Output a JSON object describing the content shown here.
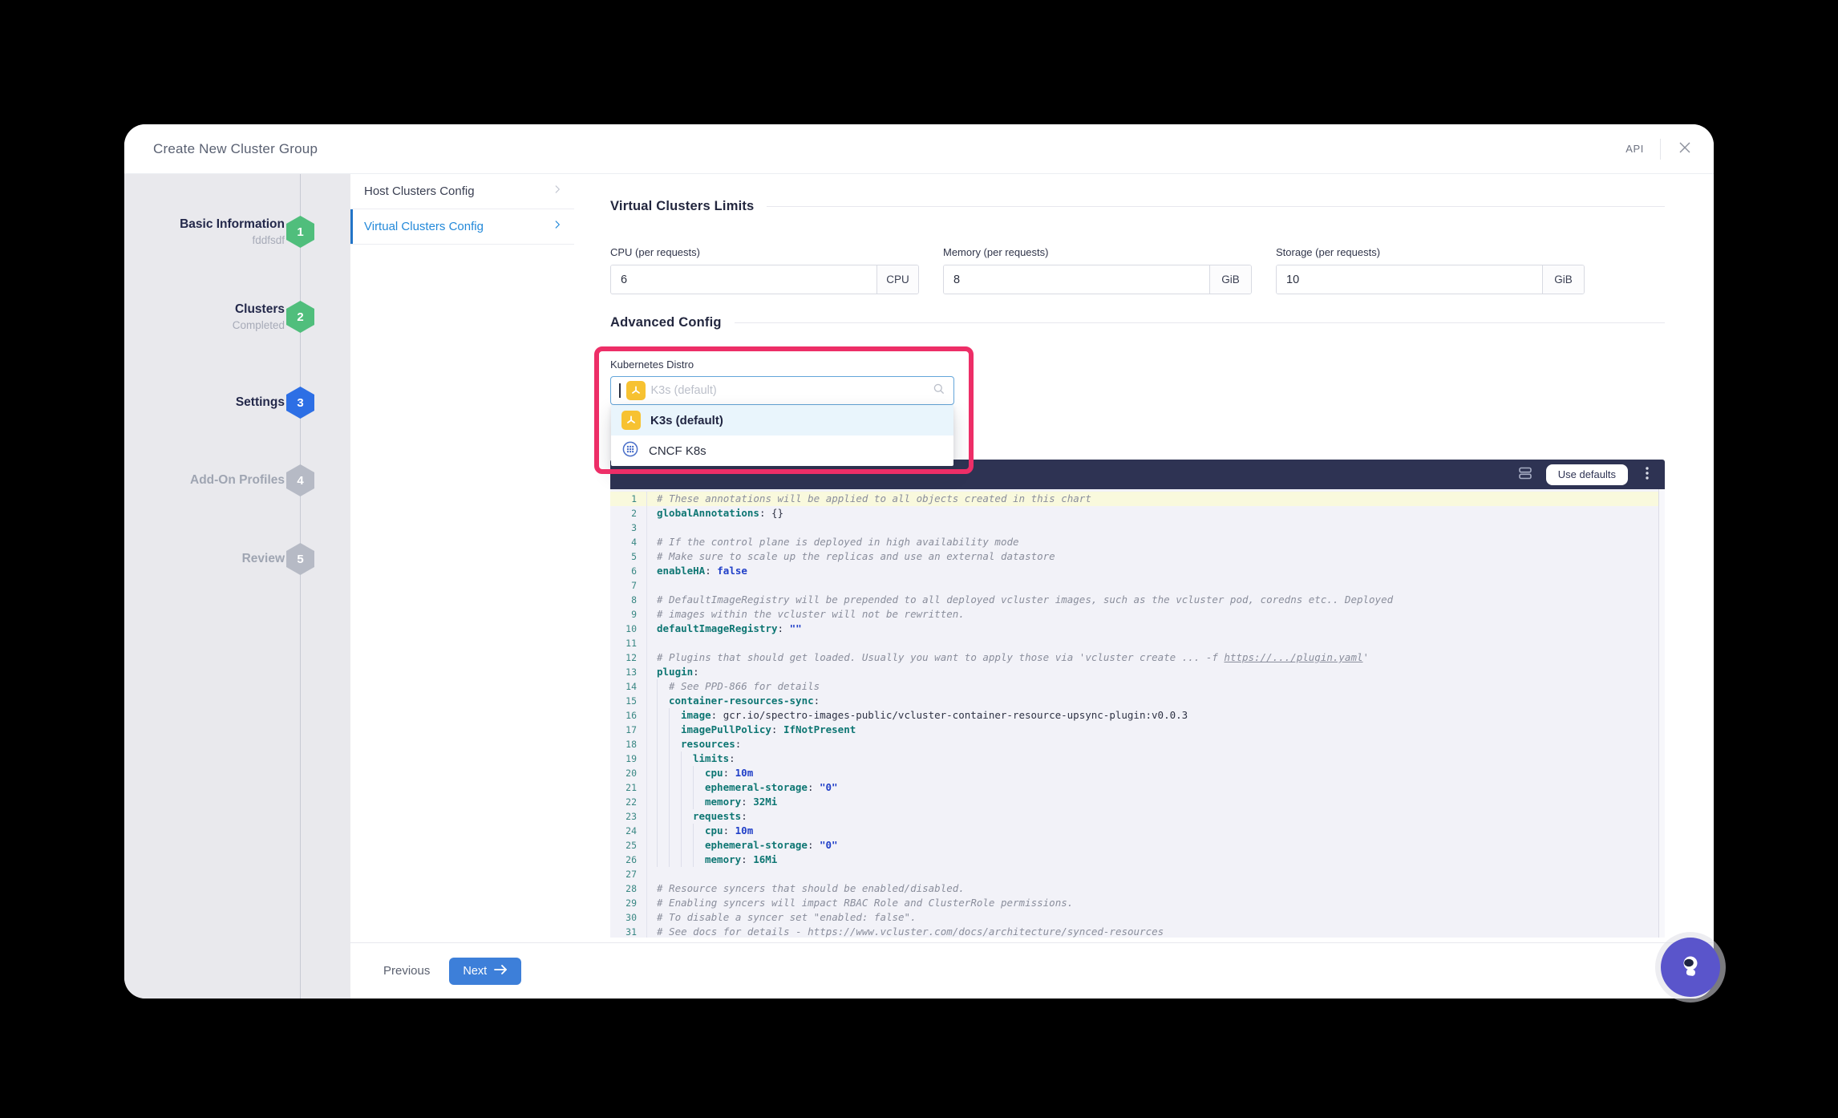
{
  "modal": {
    "title": "Create New Cluster Group",
    "api_label": "API"
  },
  "wizard": {
    "steps": [
      {
        "number": "1",
        "label": "Basic Information",
        "sublabel": "fddfsdf",
        "state": "completed"
      },
      {
        "number": "2",
        "label": "Clusters",
        "sublabel": "Completed",
        "state": "completed"
      },
      {
        "number": "3",
        "label": "Settings",
        "sublabel": "",
        "state": "active"
      },
      {
        "number": "4",
        "label": "Add-On Profiles",
        "sublabel": "",
        "state": "pending"
      },
      {
        "number": "5",
        "label": "Review",
        "sublabel": "",
        "state": "pending"
      }
    ]
  },
  "config_menu": {
    "items": [
      {
        "label": "Host Clusters Config",
        "active": false
      },
      {
        "label": "Virtual Clusters Config",
        "active": true
      }
    ]
  },
  "limits_section": {
    "title": "Virtual Clusters Limits",
    "fields": [
      {
        "label": "CPU (per requests)",
        "value": "6",
        "unit": "CPU"
      },
      {
        "label": "Memory (per requests)",
        "value": "8",
        "unit": "GiB"
      },
      {
        "label": "Storage (per requests)",
        "value": "10",
        "unit": "GiB"
      }
    ]
  },
  "advanced_section": {
    "title": "Advanced Config",
    "distro_label": "Kubernetes Distro",
    "distro_placeholder": "K3s (default)",
    "options": [
      {
        "label": "K3s (default)",
        "icon": "k3s",
        "selected": true
      },
      {
        "label": "CNCF K8s",
        "icon": "k8s",
        "selected": false
      }
    ]
  },
  "editor": {
    "use_defaults_label": "Use defaults",
    "lines": [
      {
        "n": 1,
        "hl": true,
        "segs": [
          [
            "cm",
            "# These annotations will be applied to all objects created in this chart"
          ]
        ]
      },
      {
        "n": 2,
        "segs": [
          [
            "k",
            "globalAnnotations"
          ],
          [
            "pl",
            ": {}"
          ]
        ]
      },
      {
        "n": 3,
        "segs": []
      },
      {
        "n": 4,
        "segs": [
          [
            "cm",
            "# If the control plane is deployed in high availability mode"
          ]
        ]
      },
      {
        "n": 5,
        "segs": [
          [
            "cm",
            "# Make sure to scale up the replicas and use an external datastore"
          ]
        ]
      },
      {
        "n": 6,
        "segs": [
          [
            "k",
            "enableHA"
          ],
          [
            "pl",
            ": "
          ],
          [
            "num",
            "false"
          ]
        ]
      },
      {
        "n": 7,
        "segs": []
      },
      {
        "n": 8,
        "segs": [
          [
            "cm",
            "# DefaultImageRegistry will be prepended to all deployed vcluster images, such as the vcluster pod, coredns etc.. Deployed"
          ]
        ]
      },
      {
        "n": 9,
        "segs": [
          [
            "cm",
            "# images within the vcluster will not be rewritten."
          ]
        ]
      },
      {
        "n": 10,
        "segs": [
          [
            "k",
            "defaultImageRegistry"
          ],
          [
            "pl",
            ": "
          ],
          [
            "num",
            "\"\""
          ]
        ]
      },
      {
        "n": 11,
        "segs": []
      },
      {
        "n": 12,
        "segs": [
          [
            "cm",
            "# Plugins that should get loaded. Usually you want to apply those via 'vcluster create ... -f "
          ],
          [
            "lnk",
            "https://.../plugin.yaml"
          ],
          [
            "cm",
            "'"
          ]
        ]
      },
      {
        "n": 13,
        "segs": [
          [
            "k",
            "plugin"
          ],
          [
            "pl",
            ":"
          ]
        ]
      },
      {
        "n": 14,
        "indent": 2,
        "segs": [
          [
            "cm",
            "# See PPD-866 for details"
          ]
        ]
      },
      {
        "n": 15,
        "indent": 2,
        "segs": [
          [
            "k",
            "container-resources-sync"
          ],
          [
            "pl",
            ":"
          ]
        ]
      },
      {
        "n": 16,
        "indent": 4,
        "segs": [
          [
            "k",
            "image"
          ],
          [
            "pl",
            ": gcr.io/spectro-images-public/vcluster-container-resource-upsync-plugin:v0.0.3"
          ]
        ]
      },
      {
        "n": 17,
        "indent": 4,
        "segs": [
          [
            "k",
            "imagePullPolicy"
          ],
          [
            "pl",
            ": "
          ],
          [
            "tv",
            "IfNotPresent"
          ]
        ]
      },
      {
        "n": 18,
        "indent": 4,
        "segs": [
          [
            "k",
            "resources"
          ],
          [
            "pl",
            ":"
          ]
        ]
      },
      {
        "n": 19,
        "indent": 6,
        "segs": [
          [
            "k",
            "limits"
          ],
          [
            "pl",
            ":"
          ]
        ]
      },
      {
        "n": 20,
        "indent": 8,
        "segs": [
          [
            "k",
            "cpu"
          ],
          [
            "pl",
            ": "
          ],
          [
            "num",
            "10m"
          ]
        ]
      },
      {
        "n": 21,
        "indent": 8,
        "segs": [
          [
            "k",
            "ephemeral-storage"
          ],
          [
            "pl",
            ": "
          ],
          [
            "num",
            "\"0\""
          ]
        ]
      },
      {
        "n": 22,
        "indent": 8,
        "segs": [
          [
            "k",
            "memory"
          ],
          [
            "pl",
            ": "
          ],
          [
            "tv",
            "32Mi"
          ]
        ]
      },
      {
        "n": 23,
        "indent": 6,
        "segs": [
          [
            "k",
            "requests"
          ],
          [
            "pl",
            ":"
          ]
        ]
      },
      {
        "n": 24,
        "indent": 8,
        "segs": [
          [
            "k",
            "cpu"
          ],
          [
            "pl",
            ": "
          ],
          [
            "num",
            "10m"
          ]
        ]
      },
      {
        "n": 25,
        "indent": 8,
        "segs": [
          [
            "k",
            "ephemeral-storage"
          ],
          [
            "pl",
            ": "
          ],
          [
            "num",
            "\"0\""
          ]
        ]
      },
      {
        "n": 26,
        "indent": 8,
        "segs": [
          [
            "k",
            "memory"
          ],
          [
            "pl",
            ": "
          ],
          [
            "tv",
            "16Mi"
          ]
        ]
      },
      {
        "n": 27,
        "segs": []
      },
      {
        "n": 28,
        "segs": [
          [
            "cm",
            "# Resource syncers that should be enabled/disabled."
          ]
        ]
      },
      {
        "n": 29,
        "segs": [
          [
            "cm",
            "# Enabling syncers will impact RBAC Role and ClusterRole permissions."
          ]
        ]
      },
      {
        "n": 30,
        "segs": [
          [
            "cm",
            "# To disable a syncer set \"enabled: false\"."
          ]
        ]
      },
      {
        "n": 31,
        "segs": [
          [
            "cm",
            "# See docs for details - https://www.vcluster.com/docs/architecture/synced-resources"
          ]
        ]
      }
    ]
  },
  "footer": {
    "previous_label": "Previous",
    "next_label": "Next"
  },
  "colors": {
    "annotation-pink": "#ED2E67",
    "editor-header-navy": "#2E3353",
    "step-completed-green": "#50BE7C",
    "step-active-blue": "#2D6FE5",
    "step-pending-gray": "#B6BAC5",
    "menu-active-blue": "#2389D9",
    "next-button-blue": "#3D7FD9",
    "select-border-blue": "#64A6DA",
    "k3s-yellow": "#F7C231",
    "k8s-blue": "#4A6FC9",
    "code-key-teal": "#0E7673",
    "code-value-blue": "#2140C8",
    "code-comment-gray": "#8A8E9C",
    "code-bg": "#F2F2F8",
    "line-highlight": "#F9F9DD",
    "option-selected-bg": "#E9F5FC",
    "help-purple": "#5A55CB"
  }
}
